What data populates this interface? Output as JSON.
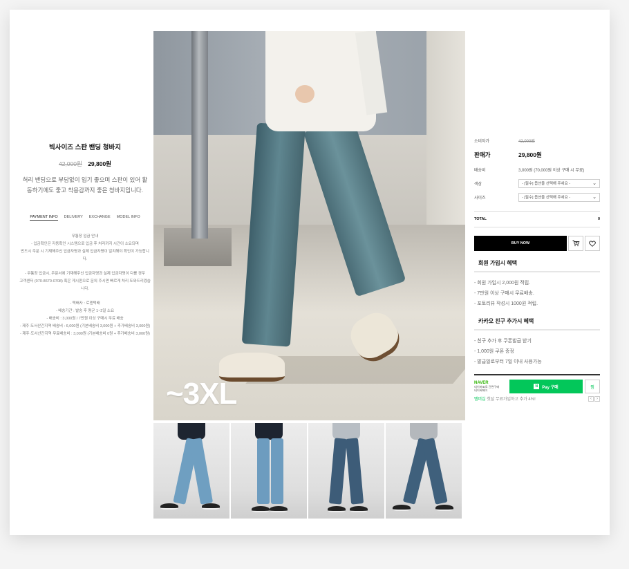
{
  "product": {
    "title": "빅사이즈 스판 밴딩 청바지",
    "old_price": "42,000원",
    "price": "29,800원",
    "description": "허리 밴딩으로 부담없이 입기 좋으며 스판이 있어 활동하기에도 좋고 착용감까지 좋은 청바지입니다."
  },
  "info_tabs": [
    "PAYMENT INFO",
    "DELIVERY",
    "EXCHANGE",
    "MODEL INFO"
  ],
  "payment_info": {
    "heading": "무통장 입금 안내",
    "lines1": [
      "- 입금확인은 자동확인 시스템으로 입금 후 처리까지 시간이 소요되며",
      "반드시 주문 시 기재해주신 입금자명과 실제 입금자명이 일치해야 확인이 가능합니다."
    ],
    "lines2": [
      "- 무통장 입금시, 주문서에 기재해주신 입금자명과 실제 입금자명이 다를 경우",
      "고객센터 (070-8670-0708) 혹은 게시판으로 문의 주시면 빠르게 처리 도와드리겠습니다."
    ],
    "lines3": [
      "- 택배사 : 로젠택배",
      "- 배송기간 : 발송 후 평균 1~2일 소요",
      "- 배송비 : 3,000원 / 7만원 이상 구매시 무료 배송",
      "- 제주·도서산간지역 배송비 : 6,000원 (기본배송비 3,000원 + 추가배송비 3,000원)",
      "- 제주·도서산간지역 무료배송비 : 3,000원 (기본배송비 0원 + 추가배송비 3,000원)"
    ]
  },
  "main_image": {
    "size_label": "~3XL"
  },
  "thumbnails": [
    {
      "top": "#1e2530",
      "jean": "#6f9fc1"
    },
    {
      "top": "#1d2430",
      "jean": "#6d9cbf"
    },
    {
      "top": "#b8bec4",
      "jean": "#3d5c78"
    },
    {
      "top": "#b4b8bc",
      "jean": "#3f607c"
    }
  ],
  "order": {
    "consumer_price_label": "소비자가",
    "consumer_price": "42,000원",
    "sale_price_label": "판매가",
    "sale_price": "29,800원",
    "shipping_label": "배송비",
    "shipping": "3,000원 (70,000원 이상 구매 시 무료)",
    "color_label": "색상",
    "color_select": "- [필수] 옵션을 선택해 주세요 -",
    "size_label": "사이즈",
    "size_select": "- [필수] 옵션을 선택해 주세요 -",
    "total_label": "TOTAL",
    "total_value": "0",
    "buy_label": "BUY NOW"
  },
  "benefits": {
    "member_title": "회원 가입시 혜택",
    "member_items": [
      "- 회원 가입시 2,000원 적립.",
      "- 7만원 이상 구매시 무료배송.",
      "- 포토리뷰 작성시 1000원 적립."
    ],
    "kakao_title": "카카오 친구 추가시 혜택",
    "kakao_items": [
      "- 친구 추가 후 쿠폰발급 받기",
      "- 1,000원 쿠폰 증정",
      "- 발급일로부터 7일 이내 사용가능"
    ]
  },
  "npay": {
    "brand": "NAVER",
    "sub1": "네이버ID로 간편구매",
    "sub2": "네이버페이",
    "btn_icon": "N",
    "btn_label": "Pay 구매",
    "wish": "찜",
    "promo_green": "멤버십",
    "promo_text": "첫달 무료가입하고 추가 4%!",
    "prev": "‹",
    "next": "›"
  },
  "colors": {
    "accent_green": "#03c75a",
    "buy_bg": "#000000"
  }
}
